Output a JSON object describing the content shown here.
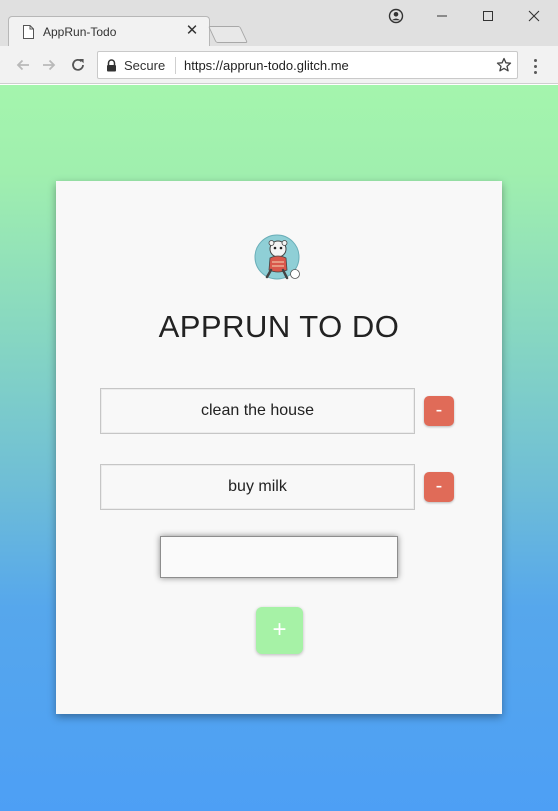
{
  "browser": {
    "tab_title": "AppRun-Todo",
    "tab_close": "✕",
    "secure_label": "Secure",
    "url": "https://apprun-todo.glitch.me"
  },
  "app": {
    "title": "APPRUN TO DO",
    "todos": [
      {
        "text": "clean the house",
        "remove_label": "-"
      },
      {
        "text": "buy milk",
        "remove_label": "-"
      }
    ],
    "new_todo_value": "",
    "add_label": "+"
  },
  "colors": {
    "remove_button": "#e06b58",
    "add_button": "#a6f2a6",
    "card": "#f8f8f8",
    "gradient_top": "#a4f5ad",
    "gradient_bottom": "#4d9ff5"
  },
  "icons": [
    "page-icon",
    "close-icon",
    "account-icon",
    "minimize-icon",
    "maximize-icon",
    "window-close-icon",
    "back-arrow-icon",
    "forward-arrow-icon",
    "reload-icon",
    "lock-icon",
    "star-icon",
    "more-menu-icon",
    "apprun-logo"
  ]
}
